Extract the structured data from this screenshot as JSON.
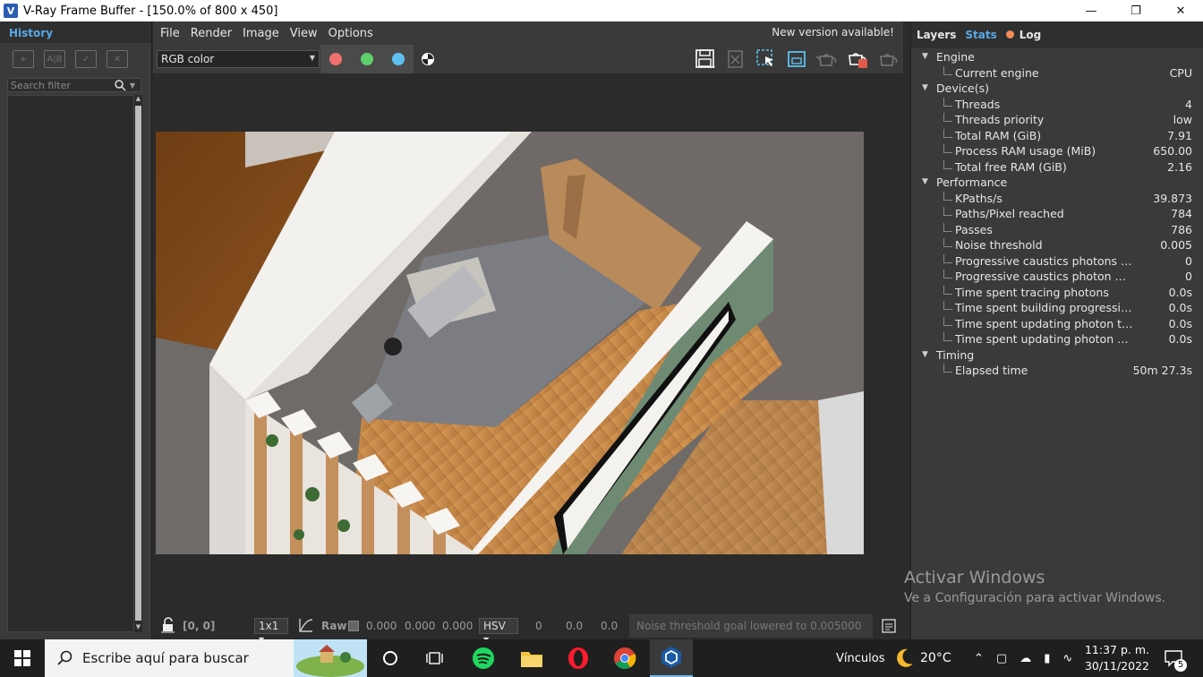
{
  "window": {
    "title": "V-Ray Frame Buffer - [150.0% of 800 x 450]",
    "app_icon": "V",
    "controls": [
      "minimize-icon",
      "restore-icon",
      "close-icon"
    ]
  },
  "history": {
    "header": "History",
    "search_placeholder": "Search filter",
    "tools": [
      "save-to-history-icon",
      "ab-compare-icon",
      "load-icon",
      "remove-icon"
    ]
  },
  "menu": [
    "File",
    "Render",
    "Image",
    "View",
    "Options"
  ],
  "new_version": "New version available!",
  "toolbar": {
    "channel": "RGB color",
    "channel_dots": [
      "#f0716f",
      "#5dcf6b",
      "#5ec0ee"
    ],
    "right_tools": [
      "save-icon",
      "clear-icon",
      "region-select-icon",
      "frame-icon",
      "teapot-icon",
      "render-teapot-icon",
      "interactive-teapot-icon"
    ]
  },
  "statusbar": {
    "coords": "[0, 0]",
    "zoom": "1x1",
    "raw_label": "Raw",
    "rgb_values": [
      "0.000",
      "0.000",
      "0.000"
    ],
    "color_mode": "HSV",
    "hsv_values": [
      "0",
      "0.0",
      "0.0"
    ],
    "message": "Noise threshold goal lowered to 0.005000"
  },
  "right_panel": {
    "tabs": [
      "Layers",
      "Stats",
      "Log"
    ],
    "active_tab": "Stats",
    "stats": [
      {
        "category": "Engine",
        "rows": [
          {
            "label": "Current engine",
            "value": "CPU"
          }
        ]
      },
      {
        "category": "Device(s)",
        "rows": [
          {
            "label": "Threads",
            "value": "4"
          },
          {
            "label": "Threads priority",
            "value": "low"
          },
          {
            "label": "Total RAM (GiB)",
            "value": "7.91"
          },
          {
            "label": "Process RAM usage (MiB)",
            "value": "650.00"
          },
          {
            "label": "Total free RAM (GiB)",
            "value": "2.16"
          }
        ]
      },
      {
        "category": "Performance",
        "rows": [
          {
            "label": "KPaths/s",
            "value": "39.873"
          },
          {
            "label": "Paths/Pixel reached",
            "value": "784"
          },
          {
            "label": "Passes",
            "value": "786"
          },
          {
            "label": "Noise threshold",
            "value": "0.005"
          },
          {
            "label": "Progressive caustics photons stor...",
            "value": "0"
          },
          {
            "label": "Progressive caustics photon map ...",
            "value": "0"
          },
          {
            "label": "Time spent tracing photons",
            "value": "0.0s"
          },
          {
            "label": "Time spent building progressive p...",
            "value": "0.0s"
          },
          {
            "label": "Time spent updating photon targ...",
            "value": "0.0s"
          },
          {
            "label": "Time spent updating photon varia...",
            "value": "0.0s"
          }
        ]
      },
      {
        "category": "Timing",
        "rows": [
          {
            "label": "Elapsed time",
            "value": "50m 27.3s"
          }
        ]
      }
    ]
  },
  "activate_windows": {
    "line1": "Activar Windows",
    "line2": "Ve a Configuración para activar Windows."
  },
  "taskbar": {
    "search_text": "Escribe aquí para buscar",
    "links": "Vínculos",
    "weather": "20°C",
    "time": "11:37 p. m.",
    "date": "30/11/2022",
    "notifications": "5"
  }
}
